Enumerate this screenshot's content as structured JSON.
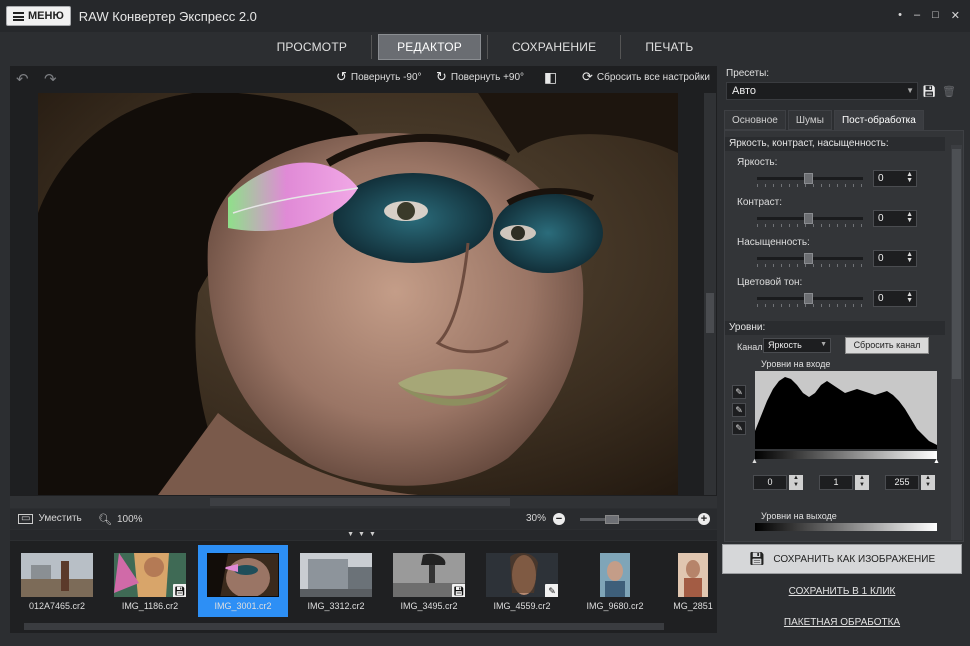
{
  "app": {
    "menu_label": "МЕНЮ",
    "title": "RAW Конвертер Экспресс 2.0",
    "window_controls": [
      "•",
      "–",
      "□",
      "✕"
    ]
  },
  "top_tabs": [
    {
      "label": "ПРОСМОТР",
      "active": false
    },
    {
      "label": "РЕДАКТОР",
      "active": true
    },
    {
      "label": "СОХРАНЕНИЕ",
      "active": false
    },
    {
      "label": "ПЕЧАТЬ",
      "active": false
    }
  ],
  "toolbar": {
    "rotate_left": "Повернуть -90°",
    "rotate_right": "Повернуть +90°",
    "reset_all": "Сбросить все настройки"
  },
  "zoom": {
    "fit_label": "Уместить",
    "zoom_100": "100%",
    "zoom_value": "30%"
  },
  "filmstrip": [
    {
      "name": "012A7465.cr2",
      "selected": false,
      "badge": ""
    },
    {
      "name": "IMG_1186.cr2",
      "selected": false,
      "badge": "save"
    },
    {
      "name": "IMG_3001.cr2",
      "selected": true,
      "badge": ""
    },
    {
      "name": "IMG_3312.cr2",
      "selected": false,
      "badge": ""
    },
    {
      "name": "IMG_3495.cr2",
      "selected": false,
      "badge": "save"
    },
    {
      "name": "IMG_4559.cr2",
      "selected": false,
      "badge": "edit"
    },
    {
      "name": "IMG_9680.cr2",
      "selected": false,
      "badge": ""
    },
    {
      "name": "MG_2851",
      "selected": false,
      "badge": ""
    }
  ],
  "presets": {
    "label": "Пресеты:",
    "value": "Авто"
  },
  "sub_tabs": [
    {
      "label": "Основное",
      "active": false
    },
    {
      "label": "Шумы",
      "active": false
    },
    {
      "label": "Пост-обработка",
      "active": true
    }
  ],
  "bcs": {
    "header": "Яркость, контраст, насыщенность:",
    "items": [
      {
        "label": "Яркость:",
        "value": "0"
      },
      {
        "label": "Контраст:",
        "value": "0"
      },
      {
        "label": "Насыщенность:",
        "value": "0"
      },
      {
        "label": "Цветовой тон:",
        "value": "0"
      }
    ]
  },
  "levels": {
    "header": "Уровни:",
    "channel_label": "Канал",
    "channel_value": "Яркость",
    "reset_channel": "Сбросить канал",
    "input_label": "Уровни на входе",
    "output_label": "Уровни на выходе",
    "input_black": "0",
    "input_gamma": "1",
    "input_white": "255"
  },
  "actions": {
    "save_as_image": "СОХРАНИТЬ КАК ИЗОБРАЖЕНИЕ",
    "save_one_click": "СОХРАНИТЬ В 1 КЛИК",
    "batch": "ПАКЕТНАЯ ОБРАБОТКА"
  }
}
